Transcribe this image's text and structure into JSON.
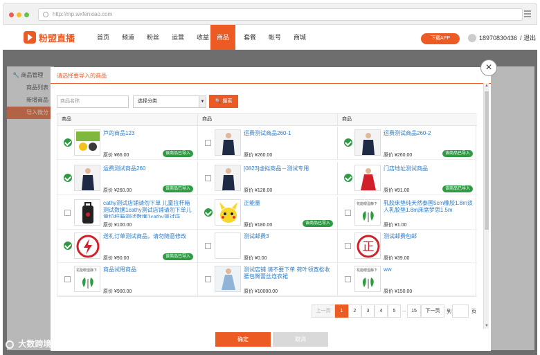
{
  "browser": {
    "url": "http://mp.wxfenxiao.com"
  },
  "header": {
    "logo": "粉盟直播",
    "nav": [
      "首页",
      "频道",
      "粉丝",
      "运营",
      "收益",
      "商品",
      "套餐",
      "帐号",
      "商城"
    ],
    "active_nav": "商品",
    "download": "下载APP",
    "phone": "18970830436",
    "logout": "/ 退出"
  },
  "sidebar": {
    "section": "商品管理",
    "items": [
      "商品列表",
      "新增商品",
      "导入微分"
    ]
  },
  "modal": {
    "title": "请选择要导入的商品",
    "search_placeholder": "商品名称",
    "category": "选择分类",
    "search_btn": "搜索",
    "col_header": "商品",
    "confirm": "确定",
    "cancel": "取消",
    "close": "×"
  },
  "products": [
    {
      "name": "芦的商品123",
      "price": "原价 ¥66.00",
      "imported": true,
      "thumb": "yellow"
    },
    {
      "name": "运费测试商品260-1",
      "price": "原价 ¥260.00",
      "imported": false,
      "thumb": "suit"
    },
    {
      "name": "运费测试商品260-2",
      "price": "原价 ¥260.00",
      "imported": true,
      "thumb": "suit"
    },
    {
      "name": "运费测试商品260",
      "price": "原价 ¥260.00",
      "imported": true,
      "thumb": "suit"
    },
    {
      "name": "[0823]虚拟商品－测试专用",
      "price": "原价 ¥128.00",
      "imported": false,
      "thumb": "suit"
    },
    {
      "name": "门店地址测试商品",
      "price": "原价 ¥91.00",
      "imported": true,
      "thumb": "red"
    },
    {
      "name": "cathy测试店铺请勿下单 儿童拉杆箱测试数据1cathy测试店铺请勿下单儿童拉杆箱测试数据1cathy测试店",
      "price": "原价 ¥100.00",
      "imported": false,
      "thumb": "luggage"
    },
    {
      "name": "正能量",
      "price": "原价 ¥180.00",
      "imported": true,
      "thumb": "pikachu"
    },
    {
      "name": "乳胶床垫纯天然泰国5cm橡胶1.8m双人乳胶垫1.8m床席梦思1.5m",
      "price": "原价 ¥1.00",
      "imported": false,
      "thumb": "placeholder"
    },
    {
      "name": "送礼订单测试商品，请勿随意修改",
      "price": "原价 ¥90.00",
      "imported": true,
      "thumb": "bolt"
    },
    {
      "name": "测试邮费3",
      "price": "原价 ¥0.00",
      "imported": false,
      "thumb": "blank"
    },
    {
      "name": "测试邮费包邮",
      "price": "原价 ¥39.00",
      "imported": false,
      "thumb": "zheng"
    },
    {
      "name": "商品试用商品",
      "price": "原价 ¥900.00",
      "imported": false,
      "thumb": "placeholder"
    },
    {
      "name": "测试店铺 请不要下单 荷叶领宽松收腰包臀蕾丝连衣裙",
      "price": "原价 ¥10000.00",
      "imported": false,
      "thumb": "dress"
    },
    {
      "name": "ww",
      "price": "原价 ¥150.00",
      "imported": false,
      "thumb": "placeholder"
    }
  ],
  "imported_label": "该商品已导入",
  "pagination": {
    "prev": "上一页",
    "pages": [
      "1",
      "2",
      "3",
      "4",
      "5"
    ],
    "ellipsis": "...",
    "last": "15",
    "next": "下一页",
    "goto_to": "到",
    "goto_page": "页"
  },
  "placeholder_thumb_text": "花能眼湿静下",
  "watermark": "大数跨境",
  "colors": {
    "accent": "#ec5b24",
    "success": "#2e9b43",
    "link": "#2d7cc8"
  }
}
